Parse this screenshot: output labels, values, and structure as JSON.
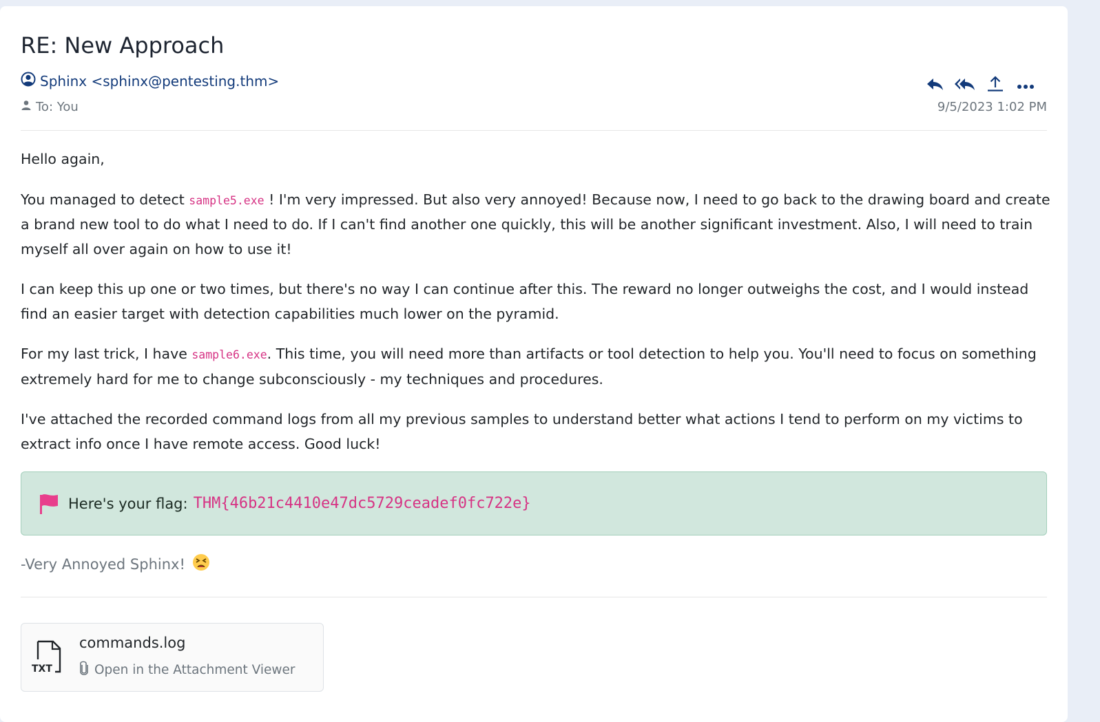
{
  "email": {
    "subject": "RE: New Approach",
    "sender": "Sphinx <sphinx@pentesting.thm>",
    "to": "To: You",
    "date": "9/5/2023 1:02 PM"
  },
  "actions": {
    "icons": [
      "reply-icon",
      "reply-all-icon",
      "forward-icon",
      "more-icon"
    ]
  },
  "body": {
    "greeting": "Hello again,",
    "p1_before": "You managed to detect ",
    "p1_code": "sample5.exe",
    "p1_after": " ! I'm very impressed. But also very annoyed! Because now, I need to go back to the drawing board and create a brand new tool to do what I need to do. If I can't find another one quickly, this will be another significant investment. Also, I will need to train myself all over again on how to use it!",
    "p2": "I can keep this up one or two times, but there's no way I can continue after this. The reward no longer outweighs the cost, and I would instead find an easier target with detection capabilities much lower on the pyramid.",
    "p3_before": "For my last trick, I have ",
    "p3_code": "sample6.exe",
    "p3_after": ". This time, you will need more than artifacts or tool detection to help you. You'll need to focus on something extremely hard for me to change subconsciously - my techniques and procedures.",
    "p4": "I've attached the recorded command logs from all my previous samples to understand better what actions I tend to perform on my victims to extract info once I have remote access. Good luck!"
  },
  "flag": {
    "label": "Here's your flag:",
    "value": "THM{46b21c4410e47dc5729ceadef0fc722e}",
    "color": "#d1e7dd"
  },
  "signoff": "-Very Annoyed Sphinx!",
  "attachment": {
    "icon_label": "TXT",
    "name": "commands.log",
    "open_label": "Open in the Attachment Viewer"
  },
  "colors": {
    "accent": "#123a7a",
    "code": "#d63384",
    "flag_icon": "#e83e8c"
  }
}
